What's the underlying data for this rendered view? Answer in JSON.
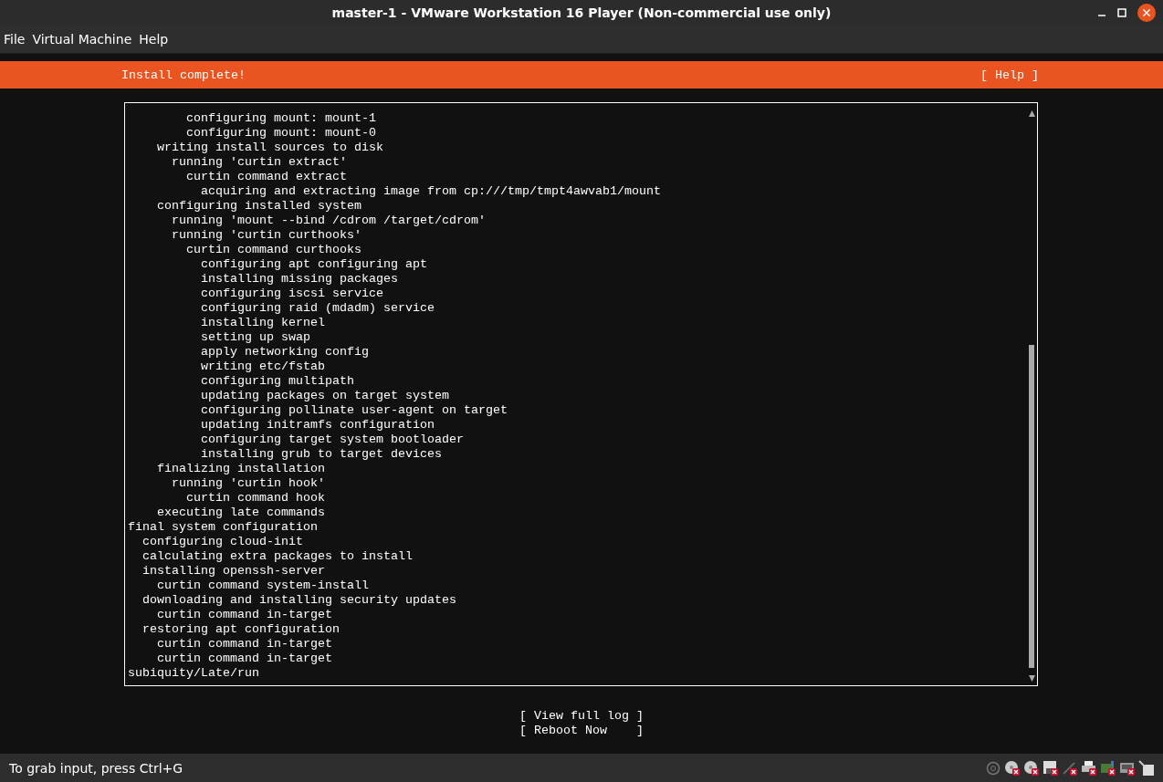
{
  "window": {
    "title": "master-1 - VMware Workstation 16 Player (Non-commercial use only)"
  },
  "menu": [
    "File",
    "Virtual Machine",
    "Help"
  ],
  "header": {
    "title": "Install complete!",
    "help": "[ Help ]"
  },
  "log": [
    {
      "children": [
        {
          "children": [
            {
              "children": [
                {
                  "children": [
                    {
                      "text": "configuring mount: mount-1"
                    },
                    {
                      "text": "configuring mount: mount-0"
                    }
                  ]
                }
              ]
            },
            {
              "text": "writing install sources to disk",
              "children": [
                {
                  "text": "running 'curtin extract'",
                  "children": [
                    {
                      "text": "curtin command extract",
                      "children": [
                        {
                          "text": "acquiring and extracting image from cp:///tmp/tmpt4awvab1/mount"
                        }
                      ]
                    }
                  ]
                }
              ]
            },
            {
              "text": "configuring installed system",
              "children": [
                {
                  "text": "running 'mount --bind /cdrom /target/cdrom'"
                },
                {
                  "text": "running 'curtin curthooks'",
                  "children": [
                    {
                      "text": "curtin command curthooks",
                      "children": [
                        {
                          "text": "configuring apt configuring apt"
                        },
                        {
                          "text": "installing missing packages"
                        },
                        {
                          "text": "configuring iscsi service"
                        },
                        {
                          "text": "configuring raid (mdadm) service"
                        },
                        {
                          "text": "installing kernel"
                        },
                        {
                          "text": "setting up swap"
                        },
                        {
                          "text": "apply networking config"
                        },
                        {
                          "text": "writing etc/fstab"
                        },
                        {
                          "text": "configuring multipath"
                        },
                        {
                          "text": "updating packages on target system"
                        },
                        {
                          "text": "configuring pollinate user-agent on target"
                        },
                        {
                          "text": "updating initramfs configuration"
                        },
                        {
                          "text": "configuring target system bootloader"
                        },
                        {
                          "text": "installing grub to target devices"
                        }
                      ]
                    }
                  ]
                }
              ]
            },
            {
              "text": "finalizing installation",
              "children": [
                {
                  "text": "running 'curtin hook'",
                  "children": [
                    {
                      "text": "curtin command hook"
                    }
                  ]
                }
              ]
            },
            {
              "text": "executing late commands"
            }
          ]
        }
      ]
    },
    {
      "text": "final system configuration",
      "children": [
        {
          "text": "configuring cloud-init"
        },
        {
          "text": "calculating extra packages to install"
        },
        {
          "text": "installing openssh-server",
          "children": [
            {
              "text": "curtin command system-install"
            }
          ]
        },
        {
          "text": "downloading and installing security updates",
          "children": [
            {
              "text": "curtin command in-target"
            }
          ]
        },
        {
          "text": "restoring apt configuration",
          "children": [
            {
              "text": "curtin command in-target"
            },
            {
              "text": "curtin command in-target"
            }
          ]
        }
      ]
    },
    {
      "text": "subiquity/Late/run"
    }
  ],
  "buttons": [
    "[ View full log ]",
    "[ Reboot Now    ]"
  ],
  "status_bar": {
    "hint": "To grab input, press Ctrl+G"
  }
}
